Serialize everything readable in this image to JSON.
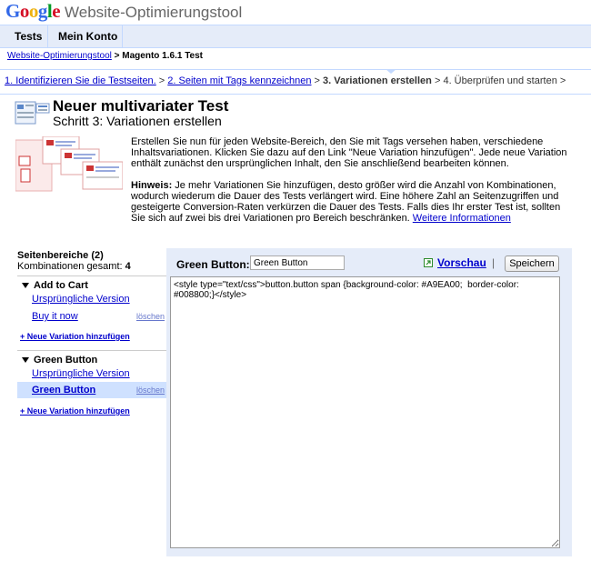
{
  "brand": {
    "logo_letters": [
      {
        "ch": "G",
        "color": "#3369e8"
      },
      {
        "ch": "o",
        "color": "#d50f25"
      },
      {
        "ch": "o",
        "color": "#eeb211"
      },
      {
        "ch": "g",
        "color": "#3369e8"
      },
      {
        "ch": "l",
        "color": "#009925"
      },
      {
        "ch": "e",
        "color": "#d50f25"
      }
    ],
    "product": "Website-Optimierungstool"
  },
  "nav": {
    "tabs": [
      "Tests",
      "Mein Konto"
    ]
  },
  "breadcrumb": {
    "root": "Website-Optimierungstool",
    "separator": ">",
    "current": "Magento 1.6.1 Test"
  },
  "steps": {
    "step1": "1. Identifizieren Sie die Testseiten.",
    "step2": "2. Seiten mit Tags kennzeichnen",
    "step3": "3. Variationen erstellen",
    "step4": "4. Überprüfen und starten",
    "arrow": ">"
  },
  "page": {
    "title": "Neuer multivariater Test",
    "subtitle": "Schritt 3: Variationen erstellen"
  },
  "intro": {
    "text": "Erstellen Sie nun für jeden Website-Bereich, den Sie mit Tags versehen haben, verschiedene Inhaltsvariationen. Klicken Sie dazu auf den Link \"Neue Variation hinzufügen\". Jede neue Variation enthält zunächst den ursprünglichen Inhalt, den Sie anschließend bearbeiten können."
  },
  "hint": {
    "label": "Hinweis:",
    "text": " Je mehr Variationen Sie hinzufügen, desto größer wird die Anzahl von Kombinationen, wodurch wiederum die Dauer des Tests verlängert wird. Eine höhere Zahl an Seitenzugriffen und gesteigerte Conversion-Raten verkürzen die Dauer des Tests. Falls dies Ihr erster Test ist, sollten Sie sich auf zwei bis drei Variationen pro Bereich beschränken. ",
    "link": "Weitere Informationen"
  },
  "sidebar": {
    "heading": "Seitenbereiche (2)",
    "combos_label": "Kombinationen gesamt:",
    "combos_value": "4",
    "sections": [
      {
        "title": "Add to Cart",
        "variations": [
          "Ursprüngliche Version",
          "Buy it now"
        ],
        "delete_label": "löschen",
        "add_label": "+ Neue Variation hinzufügen"
      },
      {
        "title": "Green Button",
        "variations": [
          "Ursprüngliche Version",
          "Green Button"
        ],
        "delete_label": "löschen",
        "add_label": "+ Neue Variation hinzufügen"
      }
    ]
  },
  "editor": {
    "label": "Green Button:",
    "name_value": "Green Button",
    "preview_label": "Vorschau",
    "separator": "|",
    "save_label": "Speichern",
    "code": "<style type=\"text/css\">button.button span {background-color: #A9EA00;  border-color: #008800;}</style>"
  },
  "colors": {
    "link": "#0000cc",
    "panel_bg": "#e5ecf9",
    "border": "#c3d9ff",
    "selection": "#c3d9ff"
  }
}
